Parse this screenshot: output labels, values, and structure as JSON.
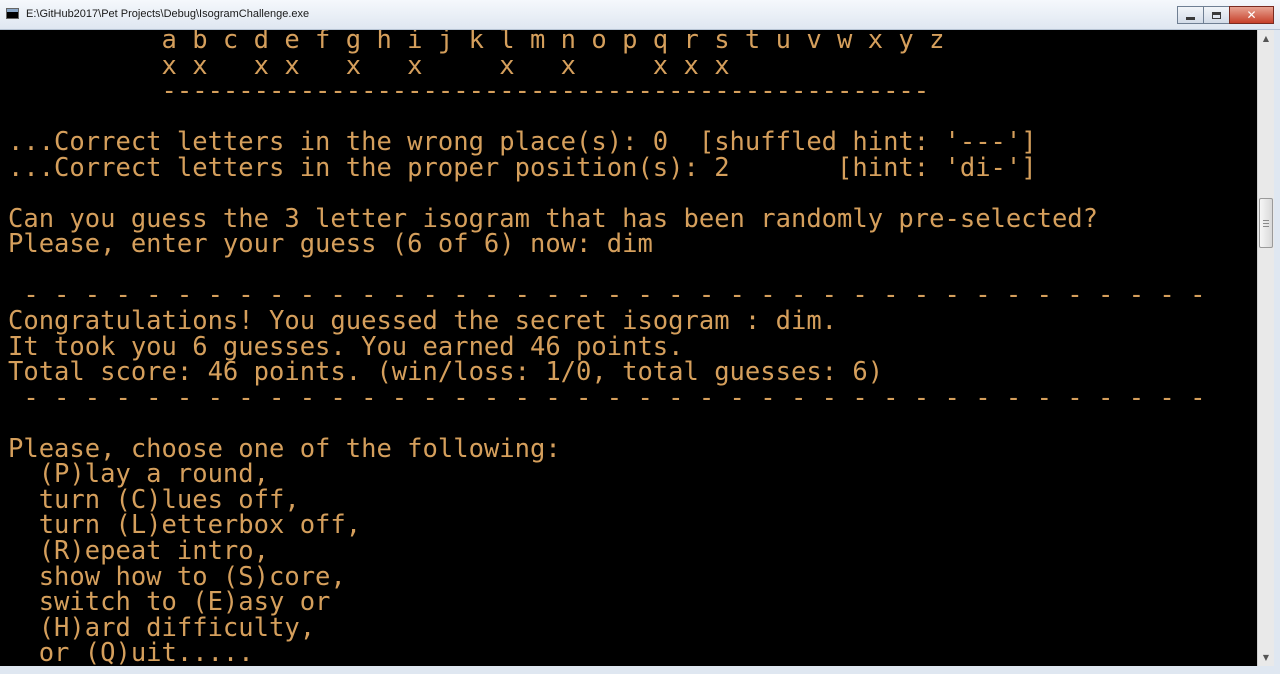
{
  "window": {
    "title": "E:\\GitHub2017\\Pet Projects\\Debug\\IsogramChallenge.exe",
    "icon": "console-app-icon",
    "buttons": {
      "minimize": "minimize-icon",
      "maximize": "maximize-icon",
      "close_glyph": "✕"
    }
  },
  "console": {
    "text_color": "#d59f5c",
    "background": "#000000",
    "lines": [
      "          a b c d e f g h i j k l m n o p q r s t u v w x y z",
      "          x x   x x   x   x     x   x     x x x",
      "          --------------------------------------------------",
      "",
      "...Correct letters in the wrong place(s): 0  [shuffled hint: '---']",
      "...Correct letters in the proper position(s): 2       [hint: 'di-']",
      "",
      "Can you guess the 3 letter isogram that has been randomly pre-selected?",
      "Please, enter your guess (6 of 6) now: dim",
      "",
      " - - - - - - - - - - - - - - - - - - - - - - - - - - - - - - - - - - - - - - -",
      "Congratulations! You guessed the secret isogram : dim.",
      "It took you 6 guesses. You earned 46 points.",
      "Total score: 46 points. (win/loss: 1/0, total guesses: 6)",
      " - - - - - - - - - - - - - - - - - - - - - - - - - - - - - - - - - - - - - - -",
      "",
      "Please, choose one of the following:",
      "  (P)lay a round,",
      "  turn (C)lues off,",
      "  turn (L)etterbox off,",
      "  (R)epeat intro,",
      "  show how to (S)core,",
      "  switch to (E)asy or",
      "  (H)ard difficulty,",
      "  or (Q)uit....."
    ]
  },
  "scrollbar": {
    "up_arrow": "▲",
    "down_arrow": "▼"
  }
}
